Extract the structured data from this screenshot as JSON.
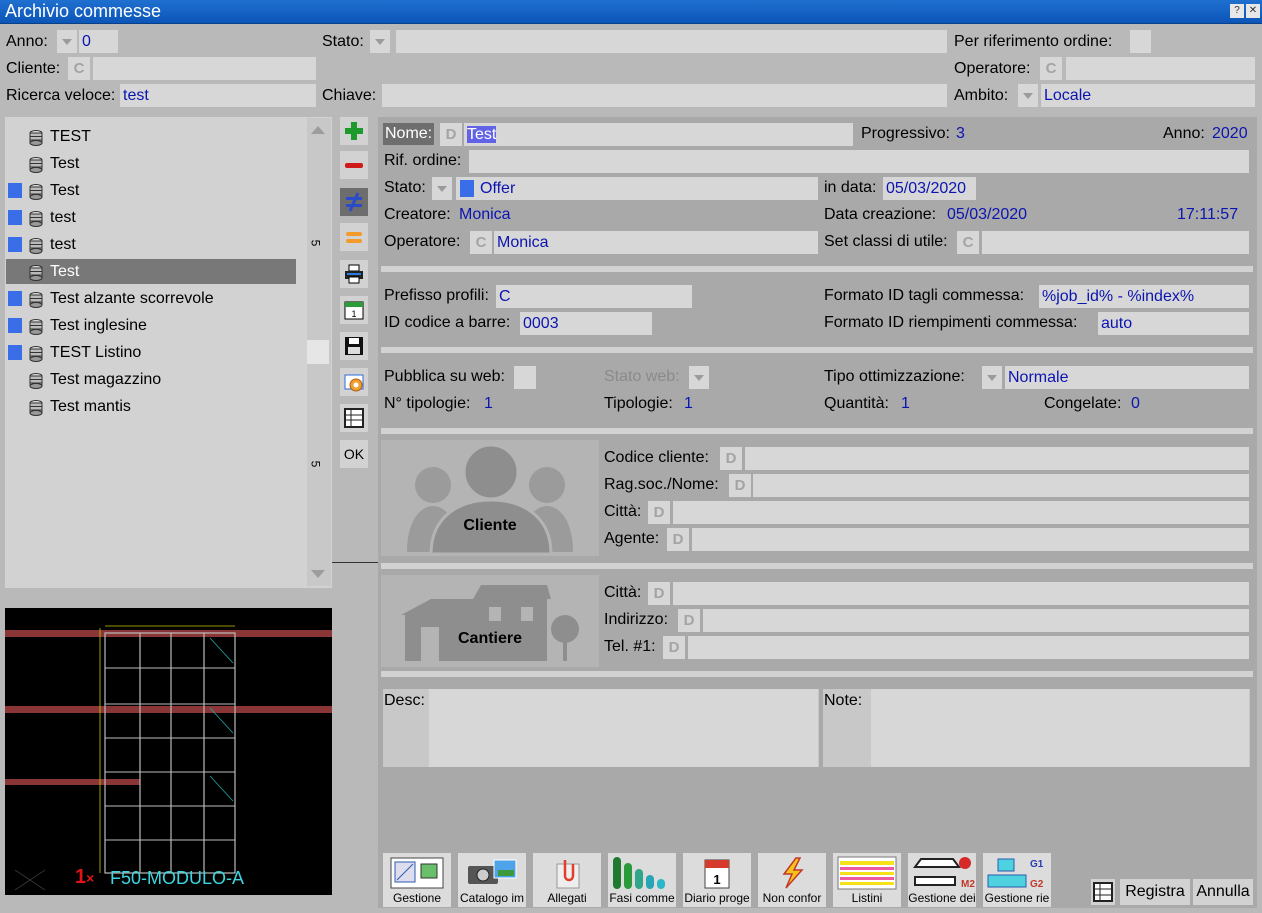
{
  "window": {
    "title": "Archivio commesse"
  },
  "filters": {
    "anno_label": "Anno:",
    "anno_value": "0",
    "stato_label": "Stato:",
    "stato_value": "",
    "rif_ordine_label": "Per riferimento ordine:",
    "cliente_label": "Cliente:",
    "cliente_btn": "C",
    "cliente_value": "",
    "operatore_label": "Operatore:",
    "operatore_btn": "C",
    "operatore_value": "",
    "ricerca_label": "Ricerca veloce:",
    "ricerca_value": "test",
    "chiave_label": "Chiave:",
    "chiave_value": "",
    "ambito_label": "Ambito:",
    "ambito_value": "Locale"
  },
  "list": {
    "items": [
      {
        "label": "TEST",
        "marked": false
      },
      {
        "label": "Test",
        "marked": false
      },
      {
        "label": "Test",
        "marked": true
      },
      {
        "label": "test",
        "marked": true
      },
      {
        "label": "test",
        "marked": true
      },
      {
        "label": "Test",
        "marked": false,
        "selected": true
      },
      {
        "label": "Test alzante scorrevole",
        "marked": true
      },
      {
        "label": "Test inglesine",
        "marked": true
      },
      {
        "label": "TEST Listino",
        "marked": true
      },
      {
        "label": "Test magazzino",
        "marked": false
      },
      {
        "label": "Test mantis",
        "marked": false
      }
    ],
    "scroll_top_label": "5",
    "scroll_bottom_label": "5",
    "mark_color": "#3a6ee8"
  },
  "toolbar": {
    "ok_label": "OK",
    "tools": [
      "add-icon",
      "remove-icon",
      "not-equal-icon",
      "equal-icon",
      "printer-icon",
      "calendar-icon",
      "save-icon",
      "globe-icon",
      "table-icon"
    ]
  },
  "preview": {
    "count": "1",
    "count_suffix": "×",
    "name": "F50-MODULO-A"
  },
  "detail": {
    "nome_label": "Nome:",
    "nome_btn": "D",
    "nome_value": "Test",
    "progressivo_label": "Progressivo:",
    "progressivo_value": "3",
    "anno_label": "Anno:",
    "anno_value": "2020",
    "rif_label": "Rif. ordine:",
    "rif_value": "",
    "stato_label": "Stato:",
    "stato_value": "Offer",
    "in_data_label": "in data:",
    "in_data_value": "05/03/2020",
    "creatore_label": "Creatore:",
    "creatore_value": "Monica",
    "data_creazione_label": "Data creazione:",
    "data_creazione_value": "05/03/2020",
    "ora_creazione_value": "17:11:57",
    "operatore_label": "Operatore:",
    "operatore_btn": "C",
    "operatore_value": "Monica",
    "set_classi_label": "Set classi di utile:",
    "set_classi_btn": "C",
    "set_classi_value": "",
    "prefisso_label": "Prefisso profili:",
    "prefisso_value": "C",
    "formato_tagli_label": "Formato ID tagli commessa:",
    "formato_tagli_value": "%job_id% - %index%",
    "barcode_label": "ID codice a barre:",
    "barcode_value": "0003",
    "formato_riemp_label": "Formato ID riempimenti commessa:",
    "formato_riemp_value": "auto",
    "pubblica_label": "Pubblica su web:",
    "stato_web_label": "Stato web:",
    "tipo_ott_label": "Tipo ottimizzazione:",
    "tipo_ott_value": "Normale",
    "n_tipologie_label": "N° tipologie:",
    "n_tipologie_value": "1",
    "tipologie_label": "Tipologie:",
    "tipologie_value": "1",
    "quantita_label": "Quantità:",
    "quantita_value": "1",
    "congelate_label": "Congelate:",
    "congelate_value": "0"
  },
  "cliente": {
    "title": "Cliente",
    "codice_label": "Codice cliente:",
    "ragsoc_label": "Rag.soc./Nome:",
    "citta_label": "Città:",
    "agente_label": "Agente:",
    "btn": "D"
  },
  "cantiere": {
    "title": "Cantiere",
    "citta_label": "Città:",
    "indirizzo_label": "Indirizzo:",
    "tel_label": "Tel. #1:",
    "btn": "D"
  },
  "notes": {
    "desc_label": "Desc:",
    "note_label": "Note:"
  },
  "bottom": {
    "buttons": [
      {
        "label": "Gestione",
        "icon": "management-icon"
      },
      {
        "label": "Catalogo im",
        "icon": "camera-icon"
      },
      {
        "label": "Allegati",
        "icon": "paperclip-icon"
      },
      {
        "label": "Fasi comme",
        "icon": "phases-icon"
      },
      {
        "label": "Diario proge",
        "icon": "calendar-icon"
      },
      {
        "label": "Non confor",
        "icon": "lightning-icon"
      },
      {
        "label": "Listini",
        "icon": "pricelist-icon"
      },
      {
        "label": "Gestione dei",
        "icon": "m2-icon"
      },
      {
        "label": "Gestione rie",
        "icon": "g1g2-icon"
      }
    ],
    "registra_label": "Registra",
    "annulla_label": "Annulla"
  }
}
